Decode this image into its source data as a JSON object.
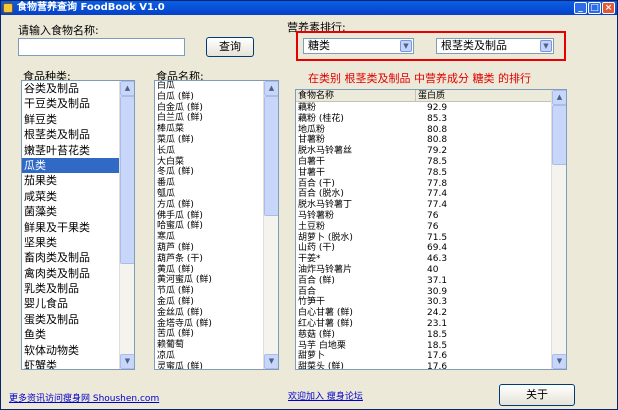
{
  "window": {
    "title": "食物营养查询 FoodBook V1.0",
    "min": "_",
    "max": "□",
    "close": "×"
  },
  "search": {
    "label": "请输入食物名称:",
    "value": "",
    "button": "查询"
  },
  "sort": {
    "label": "营养素排行:",
    "nutrient": "糖类",
    "category": "根茎类及制品",
    "note": "在类别 根茎类及制品 中营养成分 糖类 的排行"
  },
  "categories": {
    "label": "食品种类:",
    "items": [
      "谷类及制品",
      "干豆类及制品",
      "鲜豆类",
      "根茎类及制品",
      "嫩茎叶苔花类",
      "瓜类",
      "茄果类",
      "咸菜类",
      "菌藻类",
      "鲜果及干果类",
      "坚果类",
      "畜肉类及制品",
      "禽肉类及制品",
      "乳类及制品",
      "婴儿食品",
      "蛋类及制品",
      "鱼类",
      "软体动物类",
      "虾蟹类"
    ],
    "selected_index": 5
  },
  "foods": {
    "label": "食品名称:",
    "items": [
      "白瓜",
      "白瓜 (鲜)",
      "白金瓜 (鲜)",
      "白兰瓜 (鲜)",
      "棒瓜菜",
      "菜瓜 (鲜)",
      "长瓜",
      "大白菜",
      "冬瓜 (鲜)",
      "番瓜",
      "瓠瓜",
      "方瓜 (鲜)",
      "佛手瓜 (鲜)",
      "哈蜜瓜 (鲜)",
      "寒瓜",
      "葫芦 (鲜)",
      "葫芦条 (干)",
      "黄瓜 (鲜)",
      "黄河蜜瓜 (鲜)",
      "节瓜 (鲜)",
      "金瓜 (鲜)",
      "金丝瓜 (鲜)",
      "金塔寺瓜 (鲜)",
      "苦瓜 (鲜)",
      "赖葡萄",
      "凉瓜",
      "灵蜜瓜 (鲜)",
      "蛇瓜 (鲜)"
    ]
  },
  "results": {
    "col_name": "食物名称",
    "col_value": "蛋白质",
    "rows": [
      [
        "藕粉",
        "92.9"
      ],
      [
        "藕粉 (桂花)",
        "85.3"
      ],
      [
        "地瓜粉",
        "80.8"
      ],
      [
        "甘薯粉",
        "80.8"
      ],
      [
        "脱水马铃薯丝",
        "79.2"
      ],
      [
        "白薯干",
        "78.5"
      ],
      [
        "甘薯干",
        "78.5"
      ],
      [
        "百合 (干)",
        "77.8"
      ],
      [
        "百合 (脱水)",
        "77.4"
      ],
      [
        "脱水马铃薯丁",
        "77.4"
      ],
      [
        "马铃薯粉",
        "76"
      ],
      [
        "土豆粉",
        "76"
      ],
      [
        "胡萝卜 (脱水)",
        "71.5"
      ],
      [
        "山药 (干)",
        "69.4"
      ],
      [
        "干姜*",
        "46.3"
      ],
      [
        "油炸马铃薯片",
        "40"
      ],
      [
        "百合 (鲜)",
        "37.1"
      ],
      [
        "百合",
        "30.9"
      ],
      [
        "竹笋干",
        "30.3"
      ],
      [
        "白心甘薯 (鲜)",
        "24.2"
      ],
      [
        "红心甘薯 (鲜)",
        "23.1"
      ],
      [
        "慈菇 (鲜)",
        "18.5"
      ],
      [
        "马芋 白地栗",
        "18.5"
      ],
      [
        "甜萝卜",
        "17.6"
      ],
      [
        "甜菜头 (鲜)",
        "17.6"
      ],
      [
        "芋头 (鲜)",
        "17.1"
      ],
      [
        "芋艿 (鲜)",
        "17.1"
      ]
    ]
  },
  "footer": {
    "link_left": "更多资讯访问瘦身网 Shoushen.com",
    "link_mid": "欢迎加入 瘦身论坛",
    "about_button": "关于"
  },
  "colors": {
    "titlebar": "#0a5fe5",
    "window_bg": "#ece9d8",
    "highlight": "#e60000",
    "selection": "#316ac5",
    "link": "#0000cc"
  }
}
